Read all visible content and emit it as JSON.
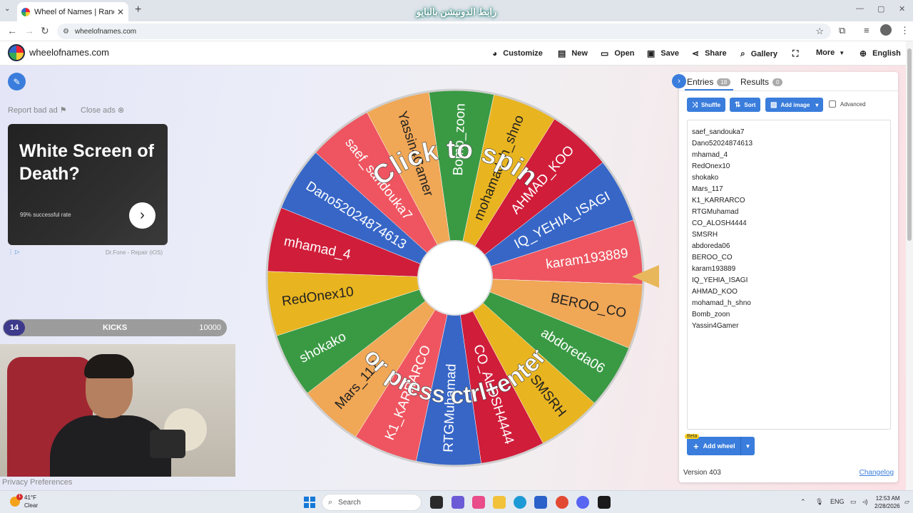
{
  "browser": {
    "tab_title": "Wheel of Names | Random nam",
    "tab_close": "✕",
    "new_tab": "+",
    "overlay_text": "رابط الدونيشن بالبايو",
    "url": "wheelofnames.com"
  },
  "site": {
    "name": "wheelofnames.com",
    "menu": {
      "customize": "Customize",
      "new": "New",
      "open": "Open",
      "save": "Save",
      "share": "Share",
      "gallery": "Gallery",
      "more": "More",
      "language": "English"
    }
  },
  "left": {
    "report_bad_ad": "Report bad ad",
    "close_ads": "Close ads",
    "ad": {
      "headline": "White Screen of Death?",
      "sub": "99% successful rate",
      "source": "Dr.Fone - Repair (iOS)"
    },
    "kicks": {
      "count": "14",
      "label": "KICKS",
      "max": "10000"
    },
    "privacy": "Privacy Preferences"
  },
  "wheel": {
    "center_text_top": "Click to spin",
    "center_text_bottom": "or press ctrl+enter",
    "segments": [
      "Bomb_zoon",
      "mohamad_h_shno",
      "AHMAD_KOO",
      "IQ_YEHIA_ISAGI",
      "karam193889",
      "BEROO_CO",
      "abdoreda06",
      "SMSRH",
      "CO_ALOSH4444",
      "RTGMuhamad",
      "K1_KARRARCO",
      "Mars_117",
      "shokako",
      "RedOnex10",
      "mhamad_4",
      "Dano52024874613",
      "saef_sandouka7",
      "Yassin4Gamer"
    ],
    "colors": [
      "#3a9a44",
      "#e8b420",
      "#d01d3a",
      "#3766c7",
      "#ee5560",
      "#f0a756",
      "#3a9a44",
      "#e8b420",
      "#d01d3a",
      "#3766c7",
      "#ee5560",
      "#f0a756",
      "#3a9a44",
      "#e8b420",
      "#d01d3a",
      "#3766c7",
      "#ee5560",
      "#f0a756"
    ]
  },
  "panel": {
    "entries_tab": "Entries",
    "entries_count": "18",
    "results_tab": "Results",
    "results_count": "0",
    "shuffle": "Shuffle",
    "sort": "Sort",
    "add_image": "Add image",
    "advanced": "Advanced",
    "entries": [
      "saef_sandouka7",
      "Dano52024874613",
      "mhamad_4",
      "RedOnex10",
      "shokako",
      "Mars_117",
      "K1_KARRARCO",
      "RTGMuhamad",
      "CO_ALOSH4444",
      "SMSRH",
      "abdoreda06",
      "BEROO_CO",
      "karam193889",
      "IQ_YEHIA_ISAGI",
      "AHMAD_KOO",
      "mohamad_h_shno",
      "Bomb_zoon",
      "Yassin4Gamer"
    ],
    "beta": "Beta",
    "add_wheel": "Add wheel",
    "version": "Version 403",
    "changelog": "Changelog"
  },
  "taskbar": {
    "temp": "41°F",
    "condition": "Clear",
    "notif": "1",
    "search": "Search",
    "lang": "ENG",
    "time": "12:53 AM",
    "date": "2/28/2026"
  }
}
